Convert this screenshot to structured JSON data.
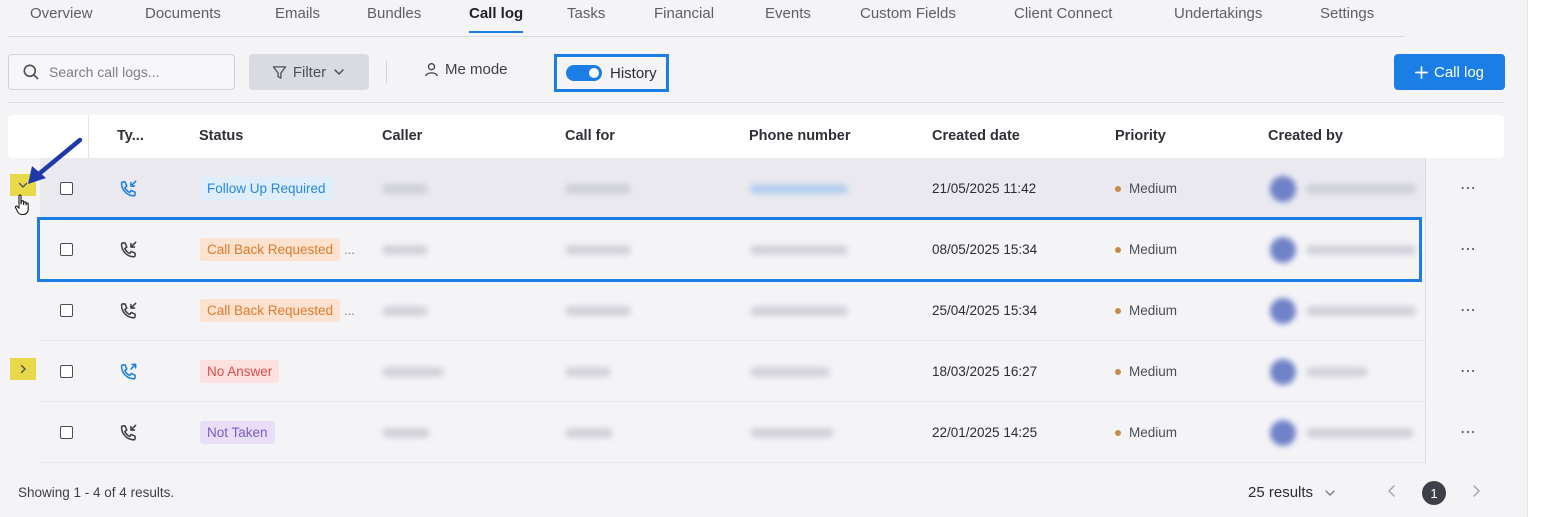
{
  "tabs": [
    {
      "label": "Overview"
    },
    {
      "label": "Documents"
    },
    {
      "label": "Emails"
    },
    {
      "label": "Bundles"
    },
    {
      "label": "Call log",
      "active": true
    },
    {
      "label": "Tasks"
    },
    {
      "label": "Financial"
    },
    {
      "label": "Events"
    },
    {
      "label": "Custom Fields"
    },
    {
      "label": "Client Connect"
    },
    {
      "label": "Undertakings"
    },
    {
      "label": "Settings"
    }
  ],
  "toolbar": {
    "search_placeholder": "Search call logs...",
    "filter_label": "Filter",
    "me_mode_label": "Me mode",
    "history_label": "History",
    "history_on": true,
    "add_label": "Call log"
  },
  "table": {
    "headers": {
      "type": "Ty...",
      "status": "Status",
      "caller": "Caller",
      "call_for": "Call for",
      "phone": "Phone number",
      "created_date": "Created date",
      "priority": "Priority",
      "created_by": "Created by"
    },
    "rows": [
      {
        "direction": "incoming",
        "icon_color": "#1a7ee6",
        "status": "Follow Up Required",
        "status_kind": "followup",
        "truncated": "",
        "created_date": "21/05/2025 11:42",
        "priority": "Medium",
        "expander": "expanded"
      },
      {
        "direction": "incoming",
        "icon_color": "#3d4048",
        "status": "Call Back Requested",
        "status_kind": "callback",
        "truncated": "...",
        "created_date": "08/05/2025 15:34",
        "priority": "Medium",
        "expander": ""
      },
      {
        "direction": "incoming",
        "icon_color": "#3d4048",
        "status": "Call Back Requested",
        "status_kind": "callback",
        "truncated": "...",
        "created_date": "25/04/2025 15:34",
        "priority": "Medium",
        "expander": ""
      },
      {
        "direction": "outgoing",
        "icon_color": "#1a7ee6",
        "status": "No Answer",
        "status_kind": "noanswer",
        "truncated": "",
        "created_date": "18/03/2025 16:27",
        "priority": "Medium",
        "expander": "collapsed"
      },
      {
        "direction": "incoming",
        "icon_color": "#3d4048",
        "status": "Not Taken",
        "status_kind": "nottaken",
        "truncated": "",
        "created_date": "22/01/2025 14:25",
        "priority": "Medium",
        "expander": ""
      }
    ]
  },
  "footer": {
    "showing": "Showing 1 - 4 of 4 results.",
    "results_per_page": "25 results",
    "current_page": "1"
  },
  "colors": {
    "accent": "#1a7ee6",
    "expander_highlight": "#e8d94a"
  }
}
